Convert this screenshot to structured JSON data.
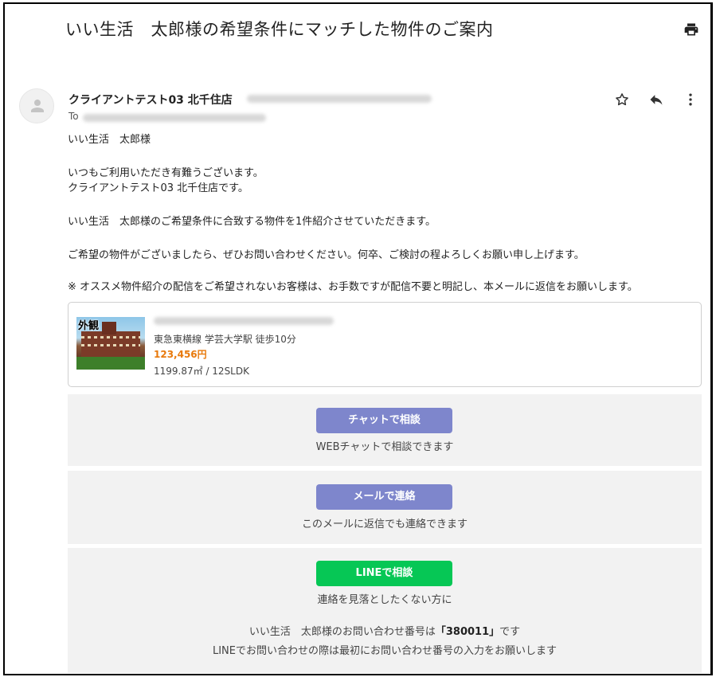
{
  "email": {
    "subject": "いい生活　太郎様の希望条件にマッチした物件のご案内",
    "sender_name": "クライアントテスト03 北千住店",
    "to_label": "To",
    "greeting": "いい生活　太郎様",
    "intro_line1": "いつもご利用いただき有難うございます。",
    "intro_line2": "クライアントテスト03 北千住店です。",
    "intro_line3": "いい生活　太郎様のご希望条件に合致する物件を1件紹介させていただきます。",
    "intro_line4": "ご希望の物件がございましたら、ぜひお問い合わせください。何卒、ご検討の程よろしくお願い申し上げます。",
    "notice": "※ オススメ物件紹介の配信をご希望されないお客様は、お手数ですが配信不要と明記し、本メールに返信をお願いします。"
  },
  "property": {
    "thumb_label": "外観",
    "station": "東急東横線 学芸大学駅 徒歩10分",
    "price": "123,456円",
    "area_layout": "1199.87㎡ / 12SLDK"
  },
  "chat": {
    "button_label": "チャットで相談",
    "caption": "WEBチャットで相談できます"
  },
  "mail": {
    "button_label": "メールで連絡",
    "caption": "このメールに返信でも連絡できます"
  },
  "line": {
    "button_label": "LINEで相談",
    "caption": "連絡を見落としたくない方に",
    "inquiry_prefix": "いい生活　太郎様のお問い合わせ番号は",
    "inquiry_number": "「380011」",
    "inquiry_suffix": "です",
    "instruction": "LINEでお問い合わせの際は最初にお問い合わせ番号の入力をお願いします"
  },
  "icons": {
    "print": "print-icon",
    "star": "star-icon",
    "reply": "reply-icon",
    "more": "more-vert-icon",
    "avatar": "person-icon"
  },
  "colors": {
    "accent_purple": "#7e86cc",
    "line_green": "#06c755",
    "price_orange": "#e8790b",
    "section_bg": "#f2f2f2"
  }
}
